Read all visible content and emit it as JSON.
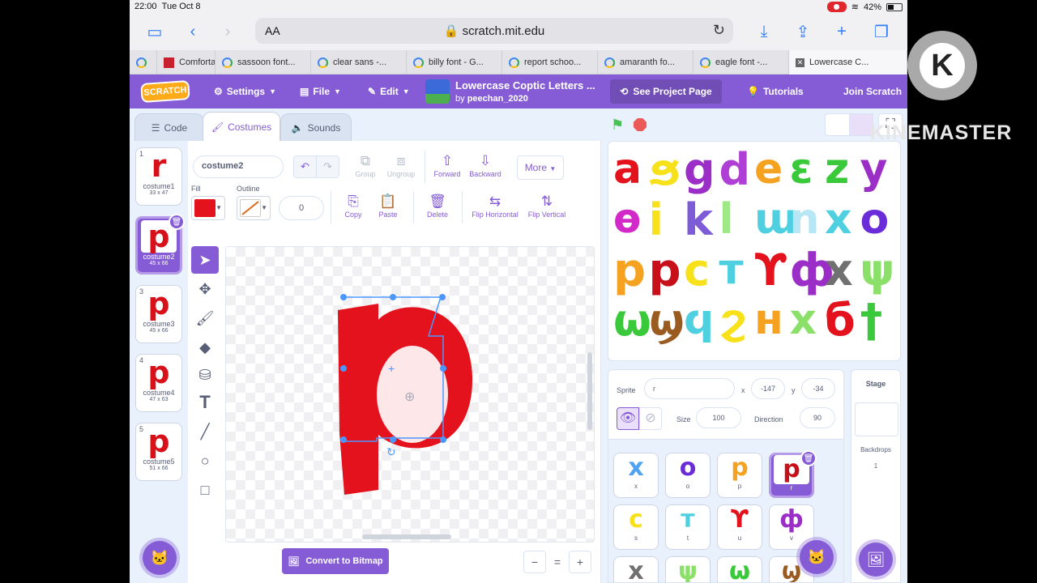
{
  "status": {
    "time": "22:00",
    "date": "Tue Oct 8",
    "battery": "42%"
  },
  "browser": {
    "aa": "AA",
    "url": "scratch.mit.edu"
  },
  "tabs": [
    {
      "label": "",
      "icon": "g"
    },
    {
      "label": "Comforta",
      "icon": "comfort"
    },
    {
      "label": "sassoon font...",
      "icon": "g"
    },
    {
      "label": "clear sans -...",
      "icon": "g"
    },
    {
      "label": "billy font - G...",
      "icon": "g"
    },
    {
      "label": "report schoo...",
      "icon": "g"
    },
    {
      "label": "amaranth fo...",
      "icon": "g"
    },
    {
      "label": "eagle font -...",
      "icon": "g"
    },
    {
      "label": "Lowercase C...",
      "icon": "close",
      "active": true
    }
  ],
  "menu": {
    "logo": "SCRATCH",
    "settings": "Settings",
    "file": "File",
    "edit": "Edit",
    "project_title": "Lowercase Coptic Letters ...",
    "by": "by",
    "author": "peechan_2020",
    "see_project": "See Project Page",
    "tutorials": "Tutorials",
    "join": "Join Scratch"
  },
  "editor_tabs": {
    "code": "Code",
    "costumes": "Costumes",
    "sounds": "Sounds"
  },
  "costumes": [
    {
      "num": "1",
      "glyph": "r",
      "name": "costume1",
      "size": "33 x 47"
    },
    {
      "num": "2",
      "glyph": "p",
      "name": "costume2",
      "size": "45 x 66",
      "selected": true
    },
    {
      "num": "3",
      "glyph": "p",
      "name": "costume3",
      "size": "45 x 66"
    },
    {
      "num": "4",
      "glyph": "p",
      "name": "costume4",
      "size": "47 x 63"
    },
    {
      "num": "5",
      "glyph": "p",
      "name": "costume5",
      "size": "51 x 66"
    }
  ],
  "paint": {
    "costume_name": "costume2",
    "group": "Group",
    "ungroup": "Ungroup",
    "forward": "Forward",
    "backward": "Backward",
    "more": "More",
    "fill_label": "Fill",
    "outline_label": "Outline",
    "fill_color": "#e3121c",
    "outline_width": "0",
    "copy": "Copy",
    "paste": "Paste",
    "delete": "Delete",
    "flip_h": "Flip Horizontal",
    "flip_v": "Flip Vertical",
    "convert": "Convert to Bitmap",
    "zoom_out": "−",
    "zoom_reset": "=",
    "zoom_in": "+"
  },
  "stage_letters": [
    {
      "ch": "a",
      "color": "#e3121c"
    },
    {
      "ch": "ϧ",
      "color": "#f7e11a"
    },
    {
      "ch": "g",
      "color": "#9b2ec7"
    },
    {
      "ch": "d",
      "color": "#b03fd6"
    },
    {
      "ch": "e",
      "color": "#f4a21f"
    },
    {
      "ch": "ε",
      "color": "#39c93a"
    },
    {
      "ch": "z",
      "color": "#39c93a"
    },
    {
      "ch": "y",
      "color": "#9b2ec7"
    },
    {
      "ch": "ө",
      "color": "#d22ac8"
    },
    {
      "ch": "i",
      "color": "#f7e11a"
    },
    {
      "ch": "k",
      "color": "#7e5cd8"
    },
    {
      "ch": "l",
      "color": "#9ee886"
    },
    {
      "ch": "ɯ",
      "color": "#4fd0e0"
    },
    {
      "ch": "n",
      "color": "#b7e7f4"
    },
    {
      "ch": "x",
      "color": "#4fd0e0"
    },
    {
      "ch": "o",
      "color": "#6a2bd9"
    },
    {
      "ch": "p",
      "color": "#f4a21f"
    },
    {
      "ch": "p",
      "color": "#c8101a"
    },
    {
      "ch": "c",
      "color": "#f7e11a"
    },
    {
      "ch": "т",
      "color": "#4fd0e0"
    },
    {
      "ch": "ϒ",
      "color": "#e3121c"
    },
    {
      "ch": "ф",
      "color": "#9b2ec7"
    },
    {
      "ch": "x",
      "color": "#707070"
    },
    {
      "ch": "ψ",
      "color": "#8be06a"
    },
    {
      "ch": "ω",
      "color": "#39c93a"
    },
    {
      "ch": "ϣ",
      "color": "#9a5b20"
    },
    {
      "ch": "ϥ",
      "color": "#4fd0e0"
    },
    {
      "ch": "ϩ",
      "color": "#f7e11a"
    },
    {
      "ch": "н",
      "color": "#f4a21f"
    },
    {
      "ch": "x",
      "color": "#8be06a"
    },
    {
      "ch": "б",
      "color": "#e3121c"
    },
    {
      "ch": "†",
      "color": "#39c93a"
    }
  ],
  "sprite": {
    "sprite_label": "Sprite",
    "name": "r",
    "x_label": "x",
    "x": "-147",
    "y_label": "y",
    "y": "-34",
    "size_label": "Size",
    "size": "100",
    "direction_label": "Direction",
    "direction": "90"
  },
  "sprites": [
    {
      "ch": "x",
      "name": "x",
      "color": "#4fa3f0"
    },
    {
      "ch": "o",
      "name": "o",
      "color": "#6a2bd9"
    },
    {
      "ch": "p",
      "name": "p",
      "color": "#f4a21f"
    },
    {
      "ch": "p",
      "name": "r",
      "color": "#c8101a",
      "selected": true
    },
    {
      "ch": "c",
      "name": "s",
      "color": "#f7e11a"
    },
    {
      "ch": "т",
      "name": "t",
      "color": "#4fd0e0"
    },
    {
      "ch": "ϒ",
      "name": "u",
      "color": "#e3121c"
    },
    {
      "ch": "ф",
      "name": "v",
      "color": "#9b2ec7"
    },
    {
      "ch": "x",
      "name": "",
      "color": "#707070"
    },
    {
      "ch": "ψ",
      "name": "",
      "color": "#8be06a"
    },
    {
      "ch": "ω",
      "name": "",
      "color": "#39c93a"
    },
    {
      "ch": "ϣ",
      "name": "",
      "color": "#9a5b20"
    }
  ],
  "stage_panel": {
    "title": "Stage",
    "backdrops_label": "Backdrops",
    "backdrops_count": "1"
  },
  "watermark": {
    "letter": "K",
    "text": "KINEMASTER"
  }
}
